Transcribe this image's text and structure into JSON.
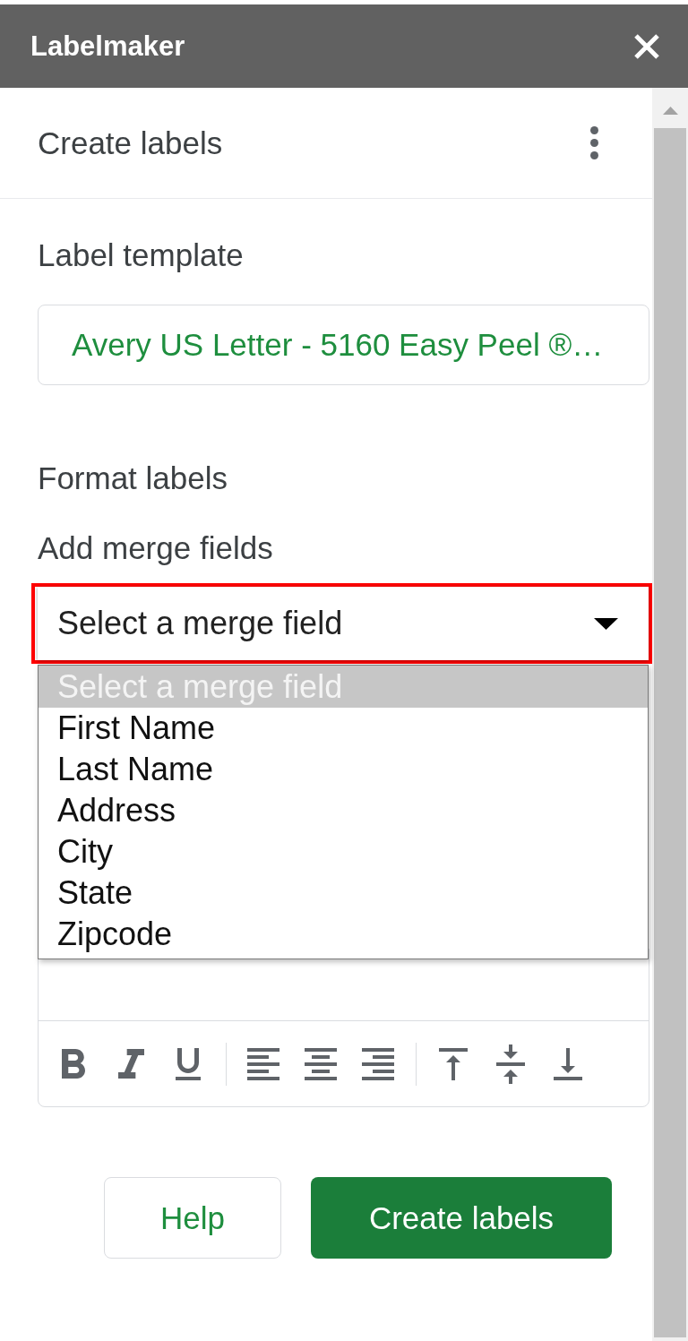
{
  "panel": {
    "title": "Labelmaker"
  },
  "header": {
    "title": "Create labels"
  },
  "label_template": {
    "label": "Label template",
    "value": "Avery US Letter - 5160 Easy Peel ®…"
  },
  "format_labels": {
    "heading": "Format labels",
    "merge_fields_label": "Add merge fields",
    "merge_field_select": {
      "value": "Select a merge field",
      "highlighted": true,
      "expanded": true,
      "options": [
        {
          "label": "Select a merge field",
          "selected": true
        },
        {
          "label": "First Name",
          "selected": false
        },
        {
          "label": "Last Name",
          "selected": false
        },
        {
          "label": "Address",
          "selected": false
        },
        {
          "label": "City",
          "selected": false
        },
        {
          "label": "State",
          "selected": false
        },
        {
          "label": "Zipcode",
          "selected": false
        }
      ]
    }
  },
  "buttons": [
    {
      "label": "Help",
      "kind": "secondary"
    },
    {
      "label": "Create labels",
      "kind": "primary"
    }
  ]
}
